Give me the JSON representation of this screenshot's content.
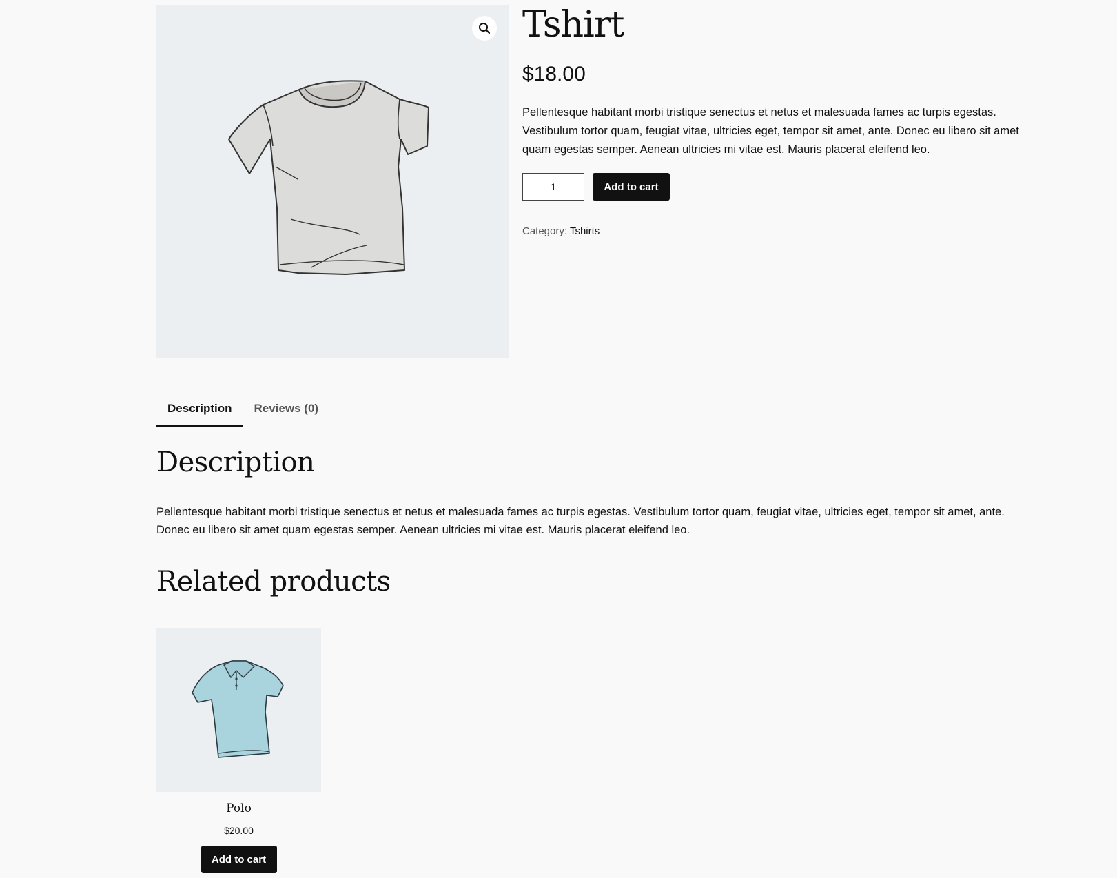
{
  "product": {
    "title": "Tshirt",
    "price": "$18.00",
    "short_description": "Pellentesque habitant morbi tristique senectus et netus et malesuada fames ac turpis egestas. Vestibulum tortor quam, feugiat vitae, ultricies eget, tempor sit amet, ante. Donec eu libero sit amet quam egestas semper. Aenean ultricies mi vitae est. Mauris placerat eleifend leo.",
    "quantity": "1",
    "add_to_cart_label": "Add to cart",
    "category_label": "Category:",
    "category_value": "Tshirts",
    "zoom_icon": "magnifier-icon"
  },
  "tabs": [
    {
      "label": "Description",
      "active": true
    },
    {
      "label": "Reviews (0)",
      "active": false
    }
  ],
  "description": {
    "heading": "Description",
    "text": "Pellentesque habitant morbi tristique senectus et netus et malesuada fames ac turpis egestas. Vestibulum tortor quam, feugiat vitae, ultricies eget, tempor sit amet, ante. Donec eu libero sit amet quam egestas semper. Aenean ultricies mi vitae est. Mauris placerat eleifend leo."
  },
  "related": {
    "heading": "Related products",
    "items": [
      {
        "name": "Polo",
        "price": "$20.00",
        "add_to_cart_label": "Add to cart"
      }
    ]
  },
  "colors": {
    "background": "#f9f9f9",
    "image_bg": "#ebeff2",
    "button": "#111111",
    "polo": "#a9d3dd",
    "tshirt": "#dcdcda"
  }
}
